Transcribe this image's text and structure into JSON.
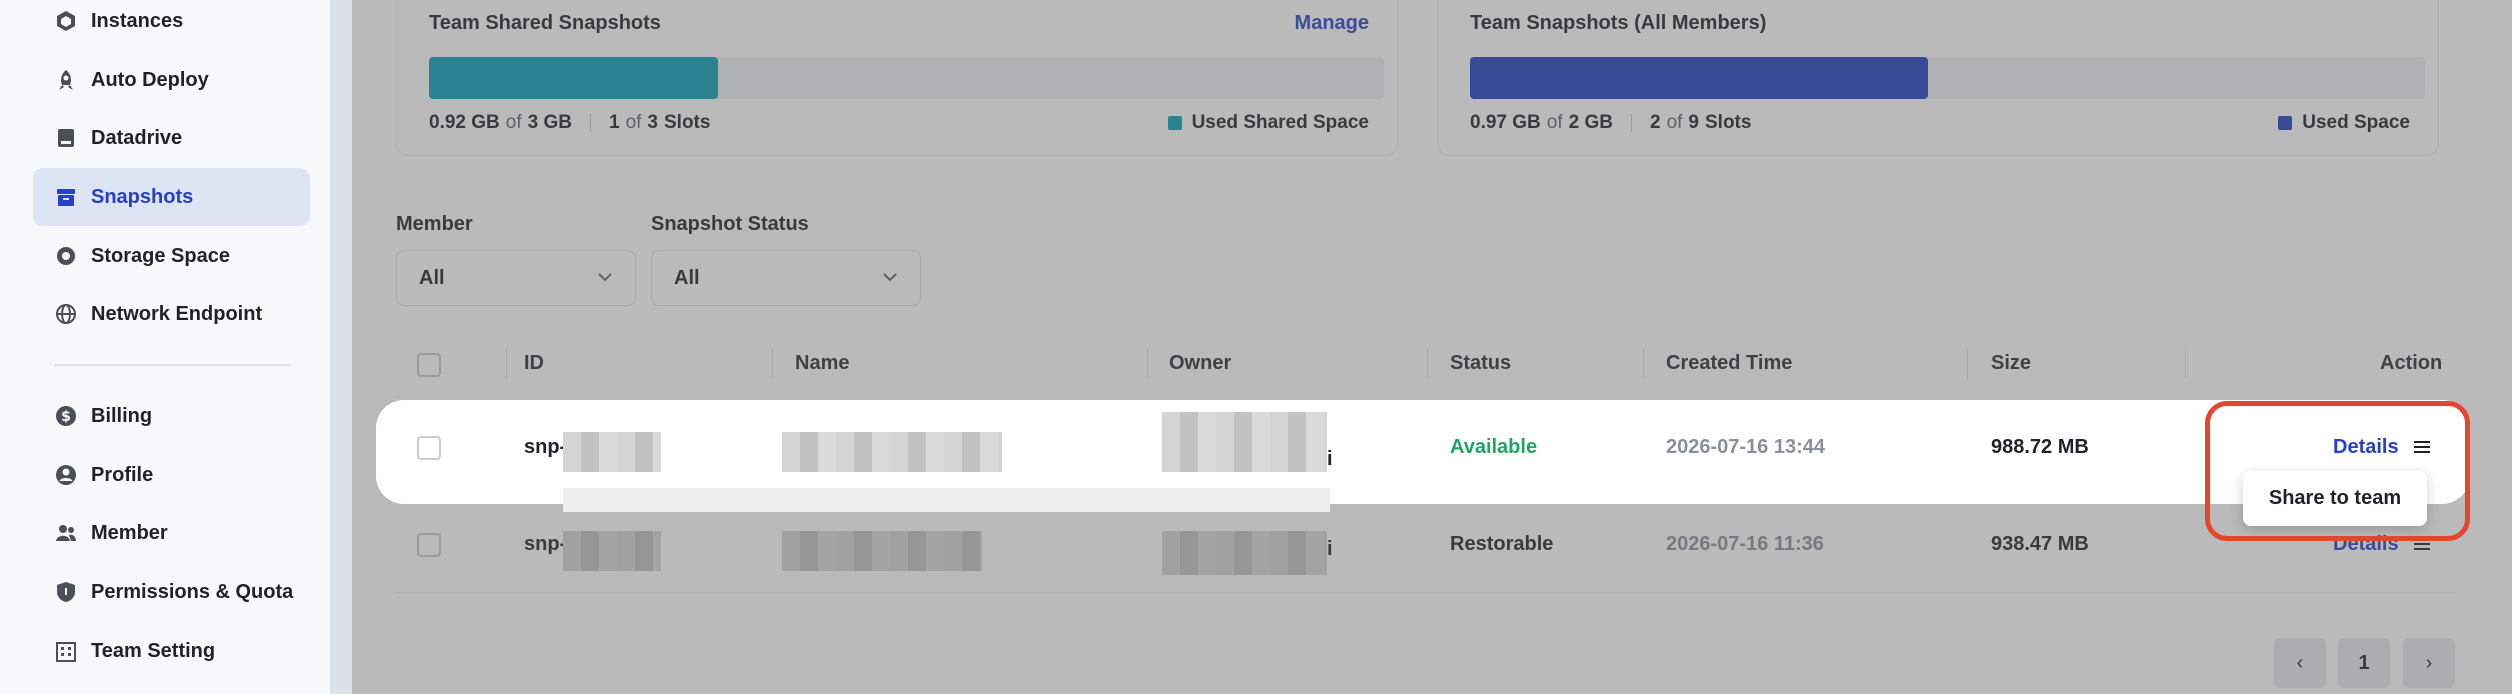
{
  "sidebar": {
    "items": [
      {
        "label": "Instances",
        "icon": "hexagon-box-icon"
      },
      {
        "label": "Auto Deploy",
        "icon": "rocket-icon"
      },
      {
        "label": "Datadrive",
        "icon": "drive-icon"
      },
      {
        "label": "Snapshots",
        "icon": "archive-box-icon",
        "active": true
      },
      {
        "label": "Storage Space",
        "icon": "storage-icon"
      },
      {
        "label": "Network Endpoint",
        "icon": "globe-icon"
      },
      {
        "label": "Billing",
        "icon": "dollar-circle-icon"
      },
      {
        "label": "Profile",
        "icon": "user-circle-icon"
      },
      {
        "label": "Member",
        "icon": "group-icon"
      },
      {
        "label": "Permissions & Quota",
        "icon": "shield-icon"
      },
      {
        "label": "Team Setting",
        "icon": "building-icon"
      }
    ]
  },
  "shared_card": {
    "title": "Team Shared Snapshots",
    "manage_label": "Manage",
    "used": "0.92 GB",
    "of_word": "of",
    "total": "3 GB",
    "slots_used": "1",
    "slots_total": "3",
    "slots_word": "Slots",
    "legend": "Used Shared Space",
    "fill_fraction": 0.303,
    "color": "#0a9fb8"
  },
  "team_card": {
    "title": "Team Snapshots (All Members)",
    "used": "0.97 GB",
    "of_word": "of",
    "total": "2 GB",
    "slots_used": "2",
    "slots_total": "9",
    "slots_word": "Slots",
    "legend": "Used Space",
    "fill_fraction": 0.48,
    "color": "#2240c0"
  },
  "filters": {
    "member_label": "Member",
    "member_value": "All",
    "status_label": "Snapshot Status",
    "status_value": "All"
  },
  "table": {
    "columns": [
      "ID",
      "Name",
      "Owner",
      "Status",
      "Created Time",
      "Size",
      "Action"
    ],
    "rows": [
      {
        "id_prefix": "snp-",
        "status": "Available",
        "created": "2026-07-16 13:44",
        "size": "988.72 MB",
        "action": "Details",
        "owner_suffix": "i"
      },
      {
        "id_prefix": "snp-",
        "status": "Restorable",
        "created": "2026-07-16 11:36",
        "size": "938.47 MB",
        "action": "Details",
        "owner_suffix": "i"
      }
    ]
  },
  "action_menu": {
    "item": "Share to team"
  },
  "pagination": {
    "prev": "‹",
    "page": "1",
    "next": "›"
  },
  "colors": {
    "accent": "#2840c8",
    "available": "#21a366",
    "highlight": "#e5442e"
  }
}
